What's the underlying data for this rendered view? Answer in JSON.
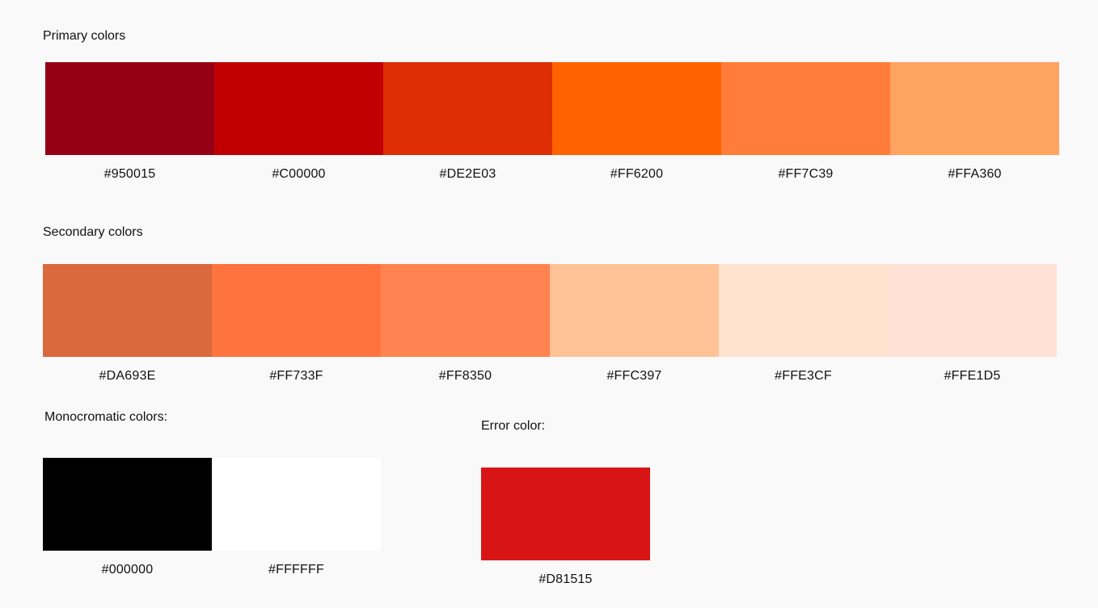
{
  "primary": {
    "title": "Primary colors",
    "colors": [
      {
        "hex": "#950015",
        "label": "#950015"
      },
      {
        "hex": "#C00000",
        "label": "#C00000"
      },
      {
        "hex": "#DE2E03",
        "label": "#DE2E03"
      },
      {
        "hex": "#FF6200",
        "label": "#FF6200"
      },
      {
        "hex": "#FF7C39",
        "label": "#FF7C39"
      },
      {
        "hex": "#FFA360",
        "label": "#FFA360"
      }
    ]
  },
  "secondary": {
    "title": "Secondary colors",
    "colors": [
      {
        "hex": "#DA693E",
        "label": "#DA693E"
      },
      {
        "hex": "#FF733F",
        "label": "#FF733F"
      },
      {
        "hex": "#FF8350",
        "label": "#FF8350"
      },
      {
        "hex": "#FFC397",
        "label": "#FFC397"
      },
      {
        "hex": "#FFE3CF",
        "label": "#FFE3CF"
      },
      {
        "hex": "#FFE1D5",
        "label": "#FFE1D5"
      }
    ]
  },
  "monochromatic": {
    "title": "Monocromatic colors:",
    "colors": [
      {
        "hex": "#000000",
        "label": "#000000"
      },
      {
        "hex": "#FFFFFF",
        "label": "#FFFFFF"
      }
    ]
  },
  "error": {
    "title": "Error color:",
    "colors": [
      {
        "hex": "#D81515",
        "label": "#D81515"
      }
    ]
  }
}
